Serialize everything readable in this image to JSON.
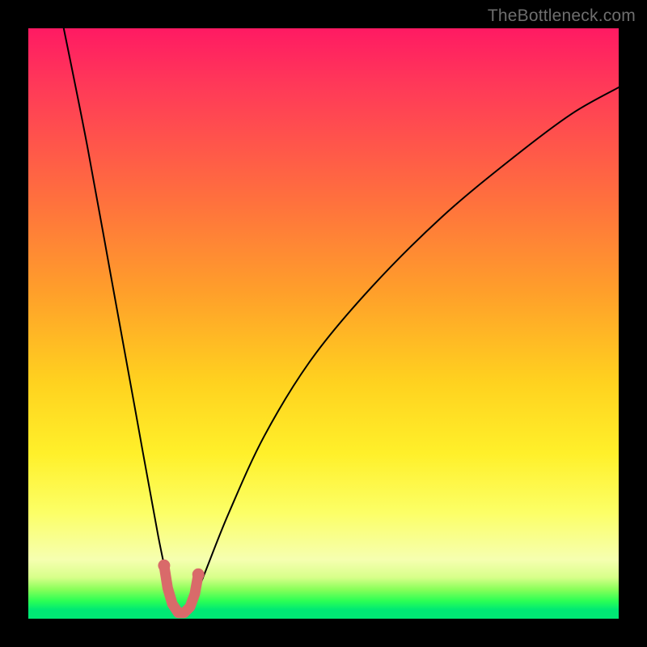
{
  "watermark": "TheBottleneck.com",
  "chart_data": {
    "type": "line",
    "title": "",
    "xlabel": "",
    "ylabel": "",
    "xlim": [
      0,
      100
    ],
    "ylim": [
      0,
      100
    ],
    "series": [
      {
        "name": "bottleneck-curve",
        "x": [
          6,
          10,
          14,
          18,
          22,
          24,
          25.5,
          27,
          28,
          30,
          34,
          40,
          48,
          58,
          70,
          82,
          92,
          100
        ],
        "y": [
          100,
          80,
          58,
          36,
          14,
          5,
          1,
          1,
          3,
          8,
          18,
          31,
          44,
          56,
          68,
          78,
          85.5,
          90
        ]
      }
    ],
    "highlight": {
      "name": "optimal-range",
      "color": "#d96a6a",
      "points_x": [
        23.0,
        23.6,
        24.4,
        25.4,
        26.4,
        27.4,
        28.2,
        28.8
      ],
      "points_y": [
        9.0,
        5.2,
        2.5,
        1.0,
        1.0,
        2.0,
        4.2,
        7.5
      ]
    },
    "gradient_stops": [
      {
        "pct": 0,
        "color": "#ff1a63"
      },
      {
        "pct": 45,
        "color": "#ffa02a"
      },
      {
        "pct": 82,
        "color": "#fcff66"
      },
      {
        "pct": 97,
        "color": "#2bff55"
      },
      {
        "pct": 100,
        "color": "#00e874"
      }
    ]
  }
}
